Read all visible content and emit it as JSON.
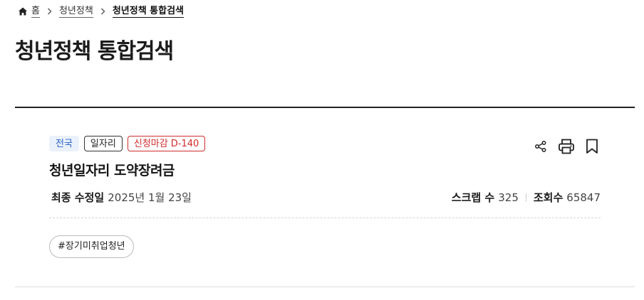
{
  "breadcrumb": {
    "home": "홈",
    "level1": "청년정책",
    "current": "청년정책 통합검색"
  },
  "page": {
    "title": "청년정책 통합검색"
  },
  "policy": {
    "tags": {
      "region": "전국",
      "category": "일자리",
      "deadline": "신청마감 D-140"
    },
    "title": "청년일자리 도약장려금",
    "updated_label": "최종 수정일",
    "updated_value": "2025년 1월 23일",
    "scrap_label": "스크랩 수",
    "scrap_value": "325",
    "views_label": "조회수",
    "views_value": "65847",
    "hashtag": "#장기미취업청년"
  },
  "colors": {
    "deadline": "#d02b2b",
    "region_text": "#2c63c7",
    "region_bg": "#eaf1fb"
  },
  "icons": [
    "home-icon",
    "chevron-right-icon",
    "share-icon",
    "print-icon",
    "bookmark-icon"
  ]
}
